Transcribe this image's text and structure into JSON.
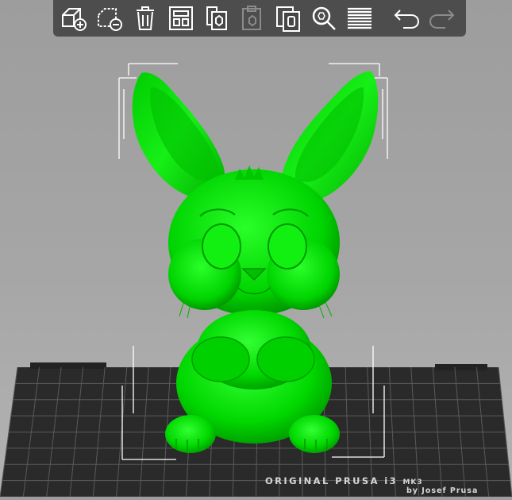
{
  "app": {
    "title": ""
  },
  "toolbar": {
    "buttons": [
      {
        "id": "add",
        "icon": "add-object-icon",
        "tooltip": ""
      },
      {
        "id": "delete",
        "icon": "delete-object-icon",
        "tooltip": ""
      },
      {
        "id": "delete-all",
        "icon": "trash-icon",
        "tooltip": ""
      },
      {
        "id": "arrange",
        "icon": "arrange-icon",
        "tooltip": ""
      },
      {
        "id": "copy",
        "icon": "copy-icon",
        "tooltip": ""
      },
      {
        "id": "paste",
        "icon": "paste-icon",
        "tooltip": "",
        "disabled": true
      },
      {
        "id": "instances",
        "icon": "instances-icon",
        "tooltip": ""
      },
      {
        "id": "search",
        "icon": "search-icon",
        "tooltip": ""
      },
      {
        "id": "layers",
        "icon": "layers-icon",
        "tooltip": ""
      },
      {
        "id": "undo",
        "icon": "undo-icon",
        "tooltip": ""
      },
      {
        "id": "redo",
        "icon": "redo-icon",
        "tooltip": "",
        "disabled": true
      }
    ]
  },
  "bed": {
    "label": "ORIGINAL PRUSA i3",
    "model_suffix": "MK3",
    "sublabel": "by Josef Prusa"
  },
  "model": {
    "name": "bunny",
    "color": "#00e600",
    "selected": true
  },
  "colors": {
    "model": "#00e600",
    "toolbar_bg": "#464646",
    "bed": "#2b2b2b",
    "grid": "#5a5a5a",
    "selection_box": "#ffffff"
  }
}
